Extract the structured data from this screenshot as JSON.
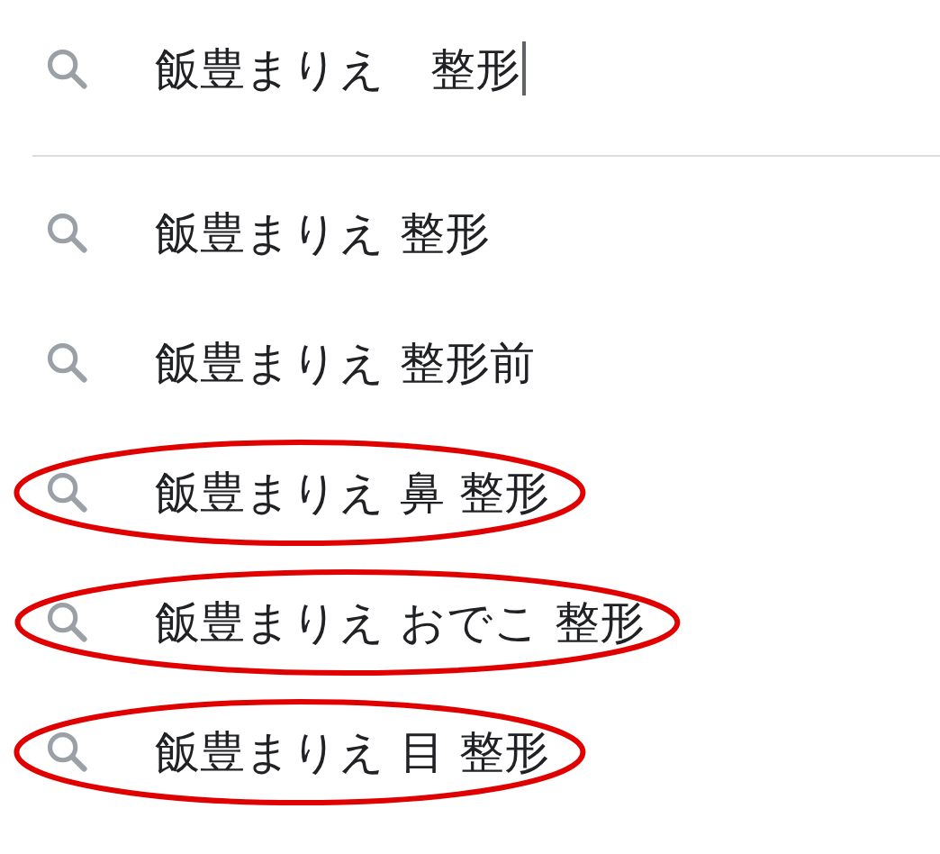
{
  "search": {
    "value": "飯豊まりえ　整形"
  },
  "suggestions": [
    {
      "text": "飯豊まりえ 整形",
      "circled": false
    },
    {
      "text": "飯豊まりえ 整形前",
      "circled": false
    },
    {
      "text": "飯豊まりえ 鼻 整形",
      "circled": true
    },
    {
      "text": "飯豊まりえ おでこ 整形",
      "circled": true
    },
    {
      "text": "飯豊まりえ 目 整形",
      "circled": true
    }
  ]
}
